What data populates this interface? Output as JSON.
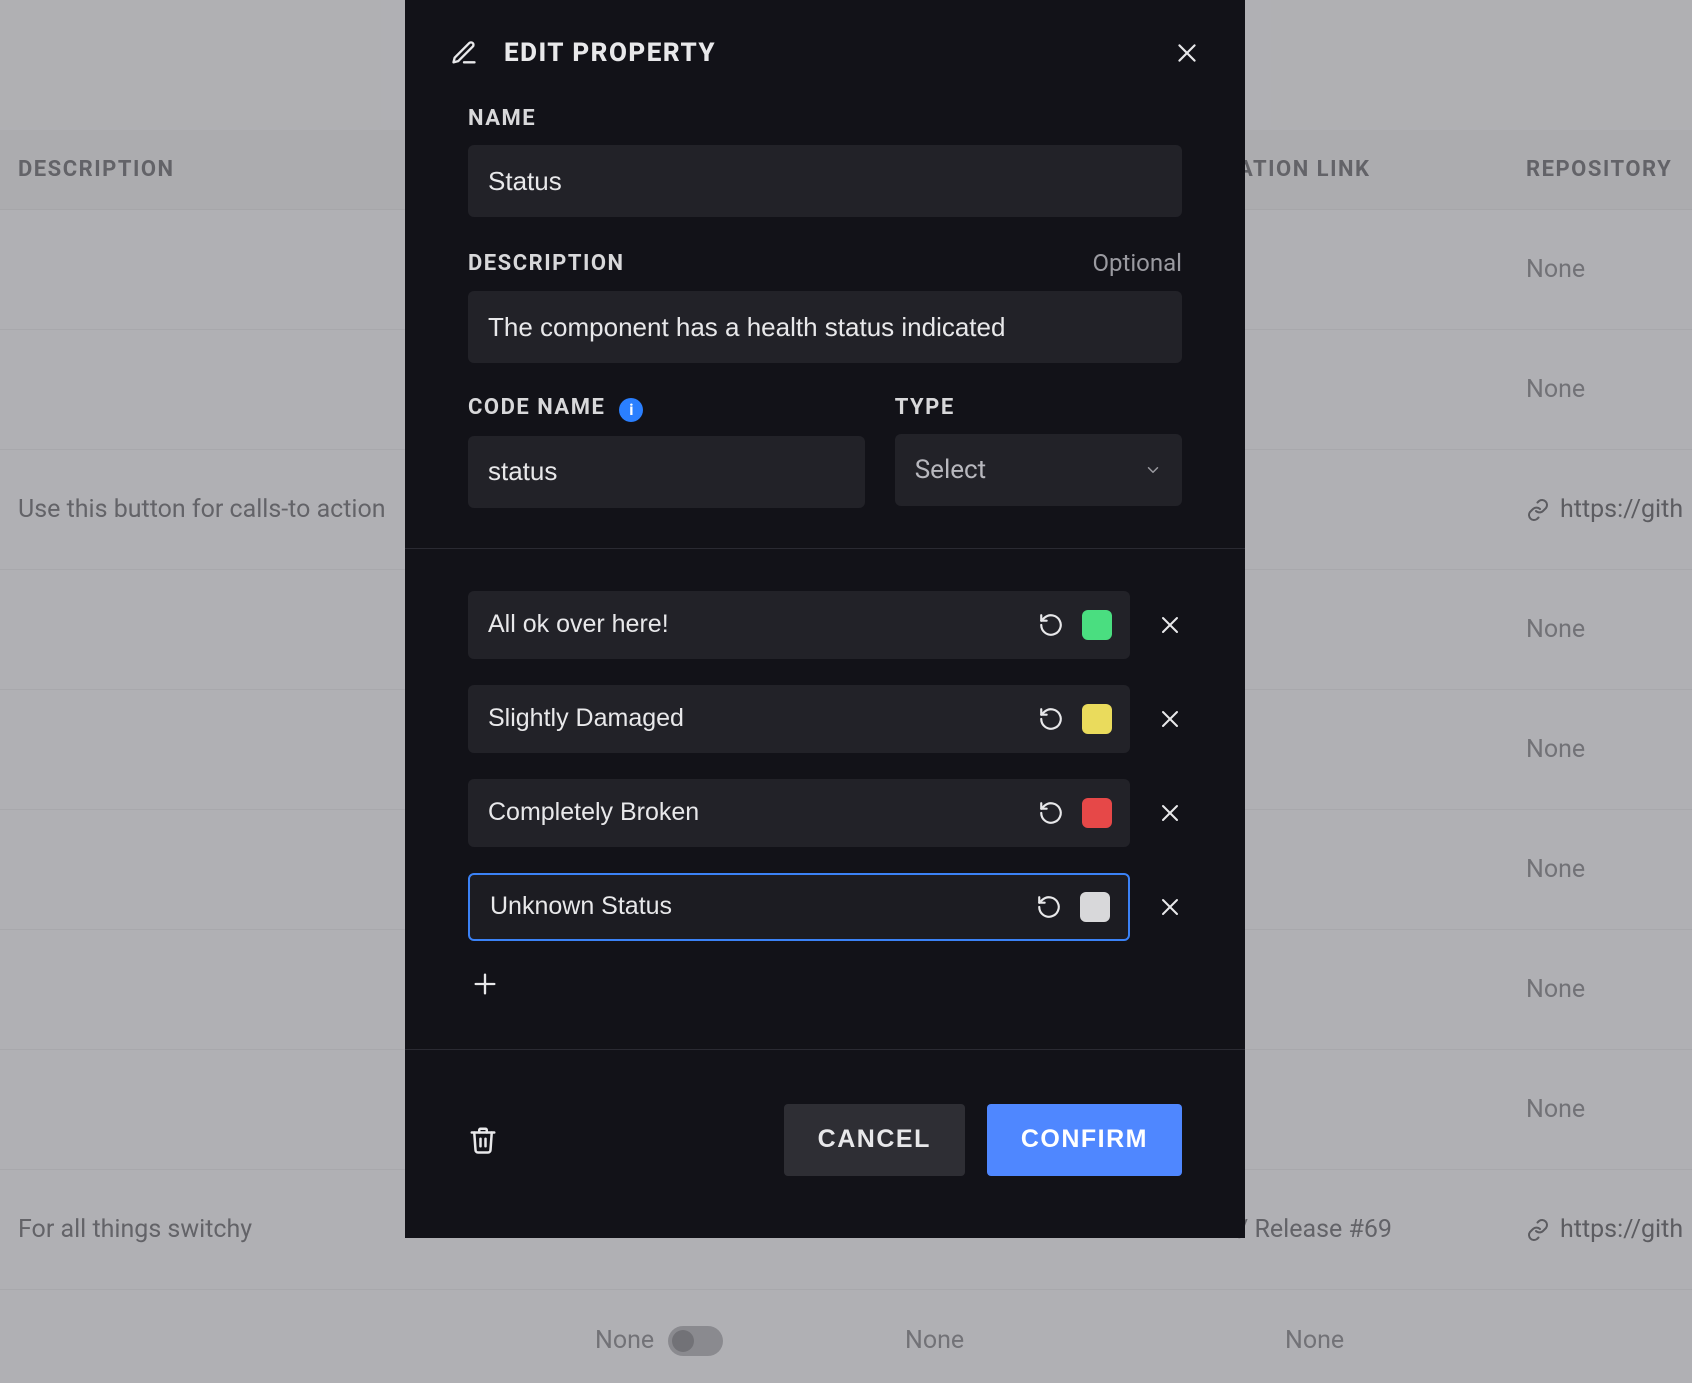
{
  "background": {
    "columns": {
      "description": "DESCRIPTION",
      "documentation_link": "ATION LINK",
      "repository": "REPOSITORY"
    },
    "rows": [
      {
        "description": "",
        "repo_type": "none",
        "repo_text": "None"
      },
      {
        "description": "",
        "repo_type": "none",
        "repo_text": "None"
      },
      {
        "description": "Use this button for calls-to action",
        "repo_type": "link",
        "repo_text": "https://gith"
      },
      {
        "description": "",
        "repo_type": "none",
        "repo_text": "None"
      },
      {
        "description": "",
        "repo_type": "none",
        "repo_text": "None"
      },
      {
        "description": "",
        "repo_type": "none",
        "repo_text": "None"
      },
      {
        "description": "",
        "repo_type": "none",
        "repo_text": "None"
      },
      {
        "description": "",
        "repo_type": "none",
        "repo_text": "None"
      },
      {
        "description": "For all things switchy",
        "release_text": "/ Release #69",
        "repo_type": "link",
        "repo_text": "https://gith"
      }
    ],
    "bottom_row": {
      "cell_a": "None",
      "cell_b_toggle": false,
      "cell_c": "None",
      "cell_d": "None"
    }
  },
  "modal": {
    "title": "EDIT PROPERTY",
    "fields": {
      "name_label": "NAME",
      "name_value": "Status",
      "description_label": "DESCRIPTION",
      "description_hint": "Optional",
      "description_value": "The component has a health status indicated",
      "codename_label": "CODE NAME",
      "codename_info": "i",
      "codename_value": "status",
      "type_label": "TYPE",
      "type_value": "Select"
    },
    "options": [
      {
        "label": "All ok over here!",
        "color": "#4ade80",
        "active": false
      },
      {
        "label": "Slightly Damaged",
        "color": "#eadb5c",
        "active": false
      },
      {
        "label": "Completely Broken",
        "color": "#e64848",
        "active": false
      },
      {
        "label": "Unknown Status",
        "color": "#d8d8da",
        "active": true
      }
    ],
    "footer": {
      "cancel": "CANCEL",
      "confirm": "CONFIRM"
    }
  }
}
